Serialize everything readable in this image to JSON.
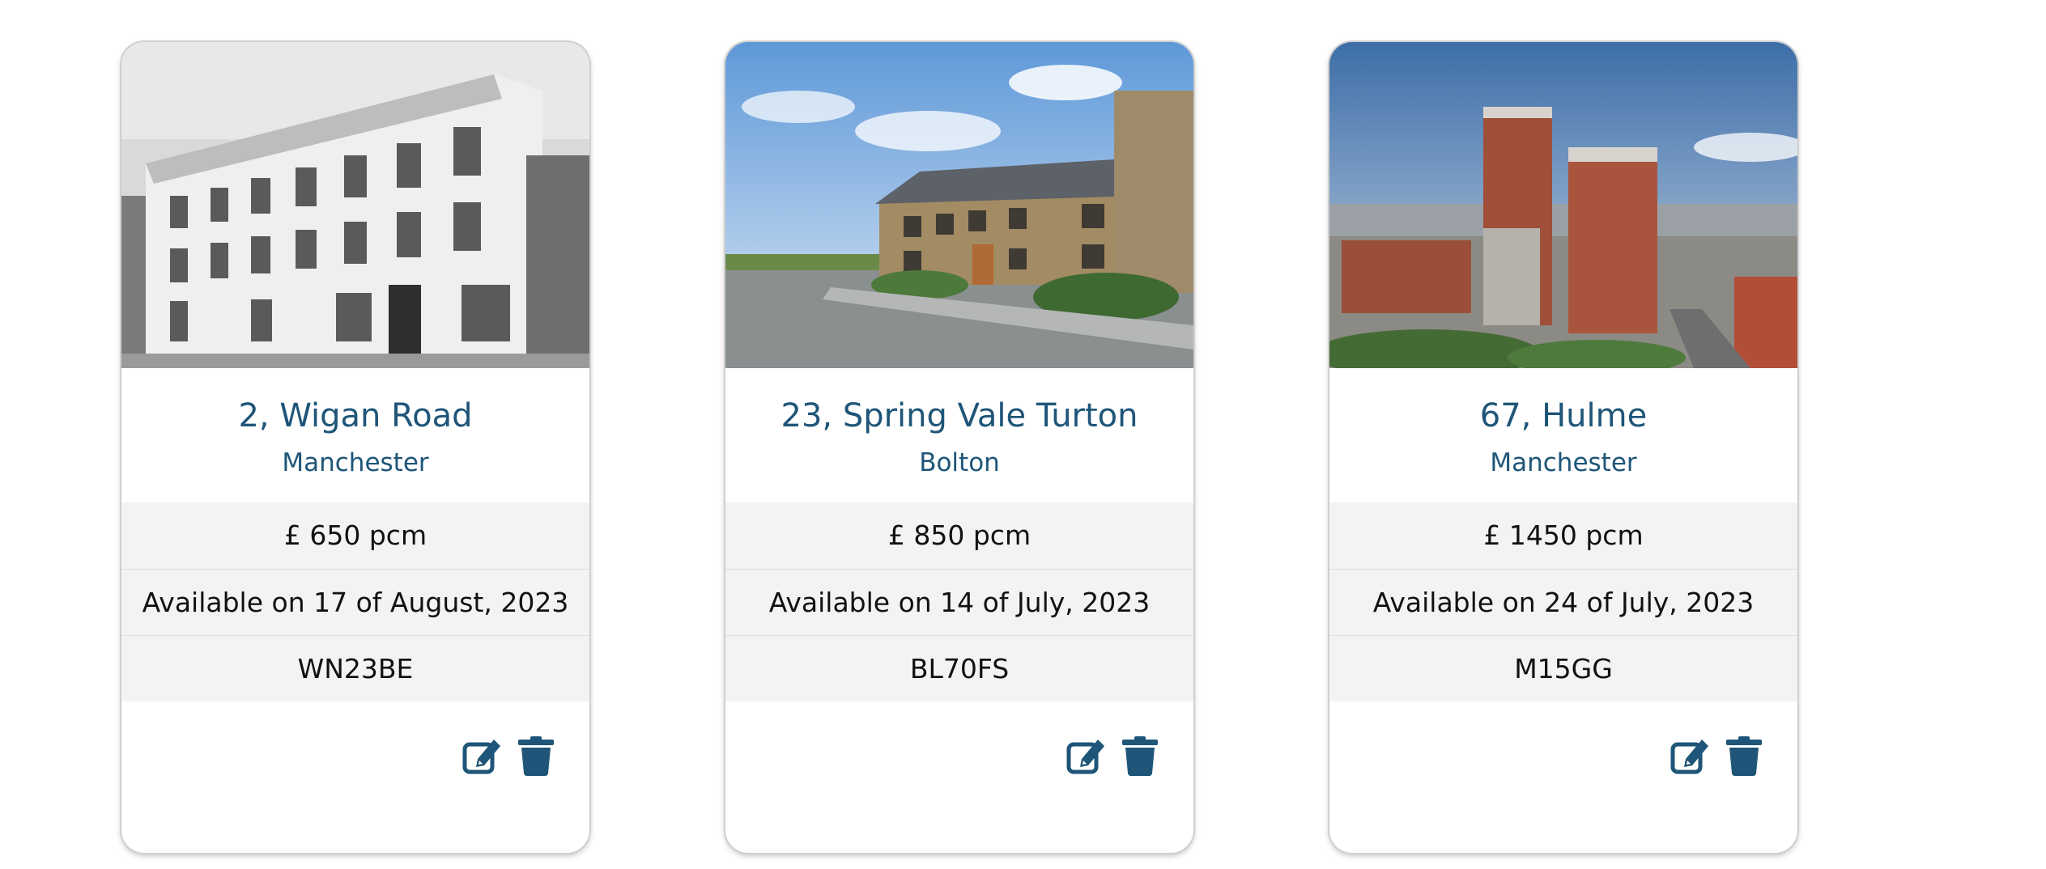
{
  "colors": {
    "accent": "#1e5578",
    "row_bg": "#f3f3f3"
  },
  "properties": [
    {
      "address": "2, Wigan Road",
      "city": "Manchester",
      "price": "£ 650 pcm",
      "available": "Available on 17 of August, 2023",
      "postcode": "WN23BE",
      "photo": "greyscale-terrace-building"
    },
    {
      "address": "23, Spring Vale Turton",
      "city": "Bolton",
      "price": "£ 850 pcm",
      "available": "Available on 14 of July, 2023",
      "postcode": "BL70FS",
      "photo": "stone-house-street"
    },
    {
      "address": "67, Hulme",
      "city": "Manchester",
      "price": "£ 1450 pcm",
      "available": "Available on 24 of July, 2023",
      "postcode": "M15GG",
      "photo": "city-tower-blocks"
    }
  ],
  "icons": {
    "edit": "edit-icon",
    "delete": "trash-icon"
  }
}
